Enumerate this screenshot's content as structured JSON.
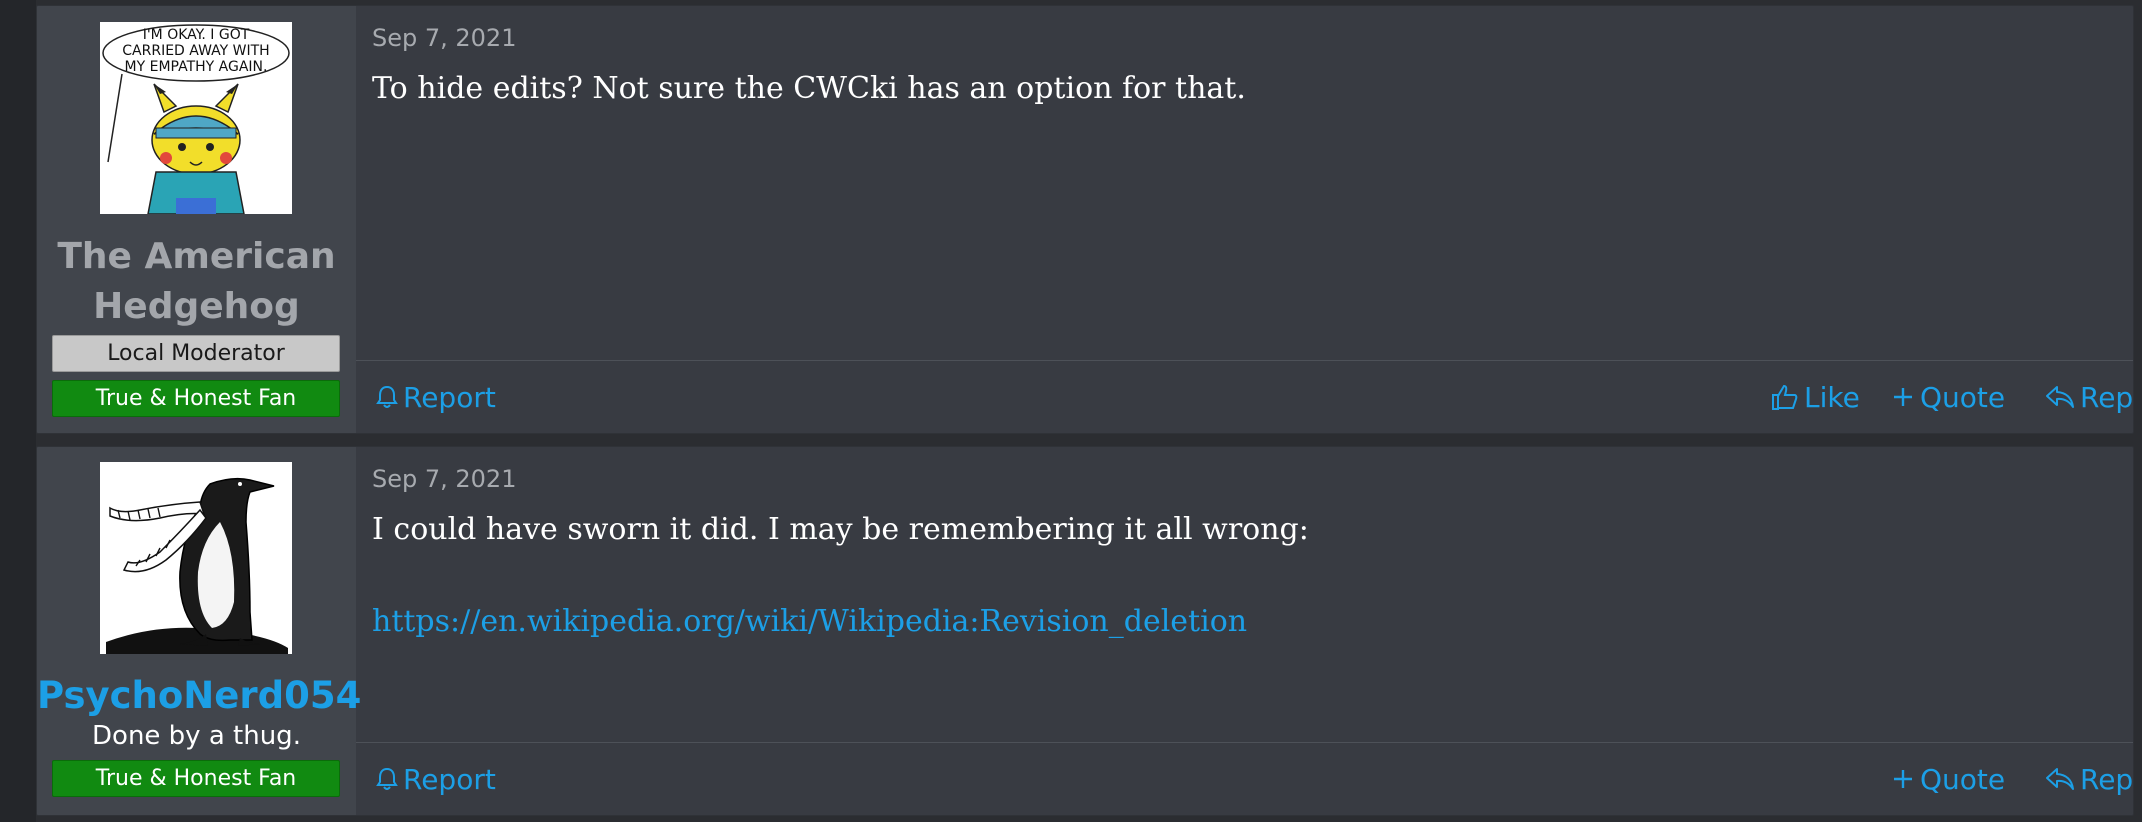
{
  "colors": {
    "link": "#1c9fe6",
    "moderator_banner": "#c8c8c8",
    "fan_banner": "#118a11",
    "username_highlight": "#1c9fe6",
    "username_muted": "#a3a6ab"
  },
  "posts": [
    {
      "avatar_text": [
        "I'M OKAY. I GOT",
        "CARRIED AWAY WITH",
        "MY EMPATHY AGAIN."
      ],
      "username": "The American Hedgehog",
      "banners": [
        "Local Moderator",
        "True & Honest Fan"
      ],
      "date": "Sep 7, 2021",
      "body": [
        "To hide edits? Not sure the CWCki has an option for that."
      ],
      "actions": {
        "report": "Report",
        "like": "Like",
        "quote": "Quote",
        "reply": "Reply"
      }
    },
    {
      "username": "PsychoNerd054",
      "user_title": "Done by a thug.",
      "banners": [
        "True & Honest Fan"
      ],
      "date": "Sep 7, 2021",
      "body": [
        "I could have sworn it did. I may be remembering it all wrong:"
      ],
      "link": "https://en.wikipedia.org/wiki/Wikipedia:Revision_deletion",
      "actions": {
        "report": "Report",
        "quote": "Quote",
        "reply": "Reply"
      }
    }
  ]
}
